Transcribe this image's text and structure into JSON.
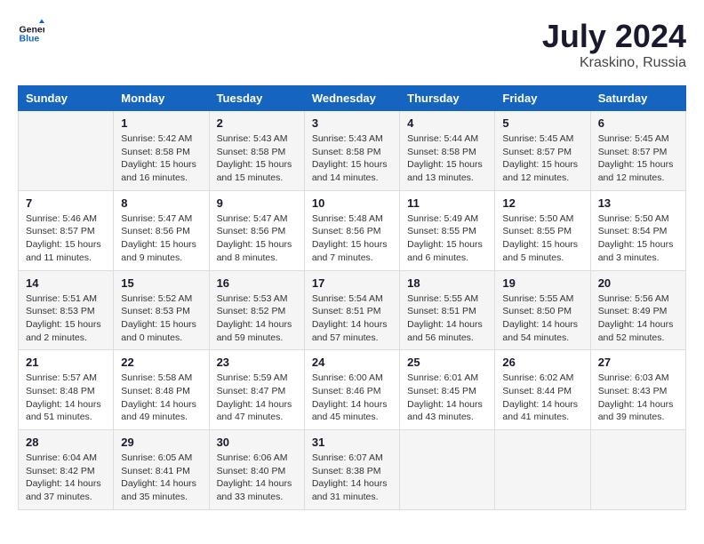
{
  "header": {
    "logo_line1": "General",
    "logo_line2": "Blue",
    "month": "July 2024",
    "location": "Kraskino, Russia"
  },
  "days_of_week": [
    "Sunday",
    "Monday",
    "Tuesday",
    "Wednesday",
    "Thursday",
    "Friday",
    "Saturday"
  ],
  "weeks": [
    [
      {
        "num": "",
        "info": ""
      },
      {
        "num": "1",
        "info": "Sunrise: 5:42 AM\nSunset: 8:58 PM\nDaylight: 15 hours\nand 16 minutes."
      },
      {
        "num": "2",
        "info": "Sunrise: 5:43 AM\nSunset: 8:58 PM\nDaylight: 15 hours\nand 15 minutes."
      },
      {
        "num": "3",
        "info": "Sunrise: 5:43 AM\nSunset: 8:58 PM\nDaylight: 15 hours\nand 14 minutes."
      },
      {
        "num": "4",
        "info": "Sunrise: 5:44 AM\nSunset: 8:58 PM\nDaylight: 15 hours\nand 13 minutes."
      },
      {
        "num": "5",
        "info": "Sunrise: 5:45 AM\nSunset: 8:57 PM\nDaylight: 15 hours\nand 12 minutes."
      },
      {
        "num": "6",
        "info": "Sunrise: 5:45 AM\nSunset: 8:57 PM\nDaylight: 15 hours\nand 12 minutes."
      }
    ],
    [
      {
        "num": "7",
        "info": "Sunrise: 5:46 AM\nSunset: 8:57 PM\nDaylight: 15 hours\nand 11 minutes."
      },
      {
        "num": "8",
        "info": "Sunrise: 5:47 AM\nSunset: 8:56 PM\nDaylight: 15 hours\nand 9 minutes."
      },
      {
        "num": "9",
        "info": "Sunrise: 5:47 AM\nSunset: 8:56 PM\nDaylight: 15 hours\nand 8 minutes."
      },
      {
        "num": "10",
        "info": "Sunrise: 5:48 AM\nSunset: 8:56 PM\nDaylight: 15 hours\nand 7 minutes."
      },
      {
        "num": "11",
        "info": "Sunrise: 5:49 AM\nSunset: 8:55 PM\nDaylight: 15 hours\nand 6 minutes."
      },
      {
        "num": "12",
        "info": "Sunrise: 5:50 AM\nSunset: 8:55 PM\nDaylight: 15 hours\nand 5 minutes."
      },
      {
        "num": "13",
        "info": "Sunrise: 5:50 AM\nSunset: 8:54 PM\nDaylight: 15 hours\nand 3 minutes."
      }
    ],
    [
      {
        "num": "14",
        "info": "Sunrise: 5:51 AM\nSunset: 8:53 PM\nDaylight: 15 hours\nand 2 minutes."
      },
      {
        "num": "15",
        "info": "Sunrise: 5:52 AM\nSunset: 8:53 PM\nDaylight: 15 hours\nand 0 minutes."
      },
      {
        "num": "16",
        "info": "Sunrise: 5:53 AM\nSunset: 8:52 PM\nDaylight: 14 hours\nand 59 minutes."
      },
      {
        "num": "17",
        "info": "Sunrise: 5:54 AM\nSunset: 8:51 PM\nDaylight: 14 hours\nand 57 minutes."
      },
      {
        "num": "18",
        "info": "Sunrise: 5:55 AM\nSunset: 8:51 PM\nDaylight: 14 hours\nand 56 minutes."
      },
      {
        "num": "19",
        "info": "Sunrise: 5:55 AM\nSunset: 8:50 PM\nDaylight: 14 hours\nand 54 minutes."
      },
      {
        "num": "20",
        "info": "Sunrise: 5:56 AM\nSunset: 8:49 PM\nDaylight: 14 hours\nand 52 minutes."
      }
    ],
    [
      {
        "num": "21",
        "info": "Sunrise: 5:57 AM\nSunset: 8:48 PM\nDaylight: 14 hours\nand 51 minutes."
      },
      {
        "num": "22",
        "info": "Sunrise: 5:58 AM\nSunset: 8:48 PM\nDaylight: 14 hours\nand 49 minutes."
      },
      {
        "num": "23",
        "info": "Sunrise: 5:59 AM\nSunset: 8:47 PM\nDaylight: 14 hours\nand 47 minutes."
      },
      {
        "num": "24",
        "info": "Sunrise: 6:00 AM\nSunset: 8:46 PM\nDaylight: 14 hours\nand 45 minutes."
      },
      {
        "num": "25",
        "info": "Sunrise: 6:01 AM\nSunset: 8:45 PM\nDaylight: 14 hours\nand 43 minutes."
      },
      {
        "num": "26",
        "info": "Sunrise: 6:02 AM\nSunset: 8:44 PM\nDaylight: 14 hours\nand 41 minutes."
      },
      {
        "num": "27",
        "info": "Sunrise: 6:03 AM\nSunset: 8:43 PM\nDaylight: 14 hours\nand 39 minutes."
      }
    ],
    [
      {
        "num": "28",
        "info": "Sunrise: 6:04 AM\nSunset: 8:42 PM\nDaylight: 14 hours\nand 37 minutes."
      },
      {
        "num": "29",
        "info": "Sunrise: 6:05 AM\nSunset: 8:41 PM\nDaylight: 14 hours\nand 35 minutes."
      },
      {
        "num": "30",
        "info": "Sunrise: 6:06 AM\nSunset: 8:40 PM\nDaylight: 14 hours\nand 33 minutes."
      },
      {
        "num": "31",
        "info": "Sunrise: 6:07 AM\nSunset: 8:38 PM\nDaylight: 14 hours\nand 31 minutes."
      },
      {
        "num": "",
        "info": ""
      },
      {
        "num": "",
        "info": ""
      },
      {
        "num": "",
        "info": ""
      }
    ]
  ]
}
